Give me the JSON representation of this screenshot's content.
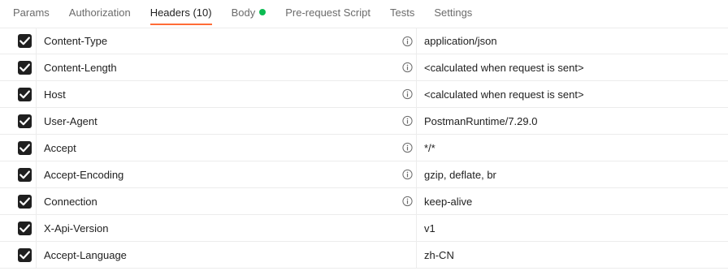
{
  "tabs": [
    {
      "label": "Params",
      "count": ""
    },
    {
      "label": "Authorization",
      "count": ""
    },
    {
      "label": "Headers",
      "count": "(10)"
    },
    {
      "label": "Body",
      "count": ""
    },
    {
      "label": "Pre-request Script",
      "count": ""
    },
    {
      "label": "Tests",
      "count": ""
    },
    {
      "label": "Settings",
      "count": ""
    }
  ],
  "active_tab": "Headers",
  "accent_color": "#ff6c37",
  "body_indicator_color": "#0cbb52",
  "headers": [
    {
      "checked": true,
      "key": "Content-Type",
      "value": "application/json",
      "info": true
    },
    {
      "checked": true,
      "key": "Content-Length",
      "value": "<calculated when request is sent>",
      "info": true
    },
    {
      "checked": true,
      "key": "Host",
      "value": "<calculated when request is sent>",
      "info": true
    },
    {
      "checked": true,
      "key": "User-Agent",
      "value": "PostmanRuntime/7.29.0",
      "info": true
    },
    {
      "checked": true,
      "key": "Accept",
      "value": "*/*",
      "info": true
    },
    {
      "checked": true,
      "key": "Accept-Encoding",
      "value": "gzip, deflate, br",
      "info": true
    },
    {
      "checked": true,
      "key": "Connection",
      "value": "keep-alive",
      "info": true
    },
    {
      "checked": true,
      "key": "X-Api-Version",
      "value": "v1",
      "info": false
    },
    {
      "checked": true,
      "key": "Accept-Language",
      "value": "zh-CN",
      "info": false
    }
  ]
}
